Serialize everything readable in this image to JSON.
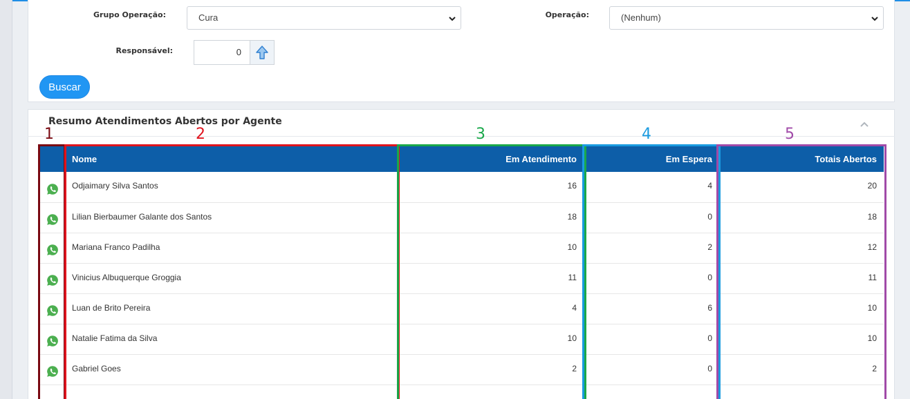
{
  "filters": {
    "grupo_label": "Grupo Operação:",
    "grupo_value": "Cura",
    "operacao_label": "Operação:",
    "operacao_value": "(Nenhum)",
    "responsavel_label": "Responsável:",
    "responsavel_value": "0",
    "buscar_label": "Buscar"
  },
  "summary": {
    "title": "Resumo Atendimentos Abertos por Agente",
    "columns": [
      "",
      "Nome",
      "Em Atendimento",
      "Em Espera",
      "Totais Abertos"
    ],
    "rows": [
      {
        "nome": "Odjaimary Silva Santos",
        "em_atendimento": "16",
        "em_espera": "4",
        "totais": "20"
      },
      {
        "nome": "Lilian Bierbaumer Galante dos Santos",
        "em_atendimento": "18",
        "em_espera": "0",
        "totais": "18"
      },
      {
        "nome": "Mariana Franco Padilha",
        "em_atendimento": "10",
        "em_espera": "2",
        "totais": "12"
      },
      {
        "nome": "Vinicius Albuquerque Groggia",
        "em_atendimento": "11",
        "em_espera": "0",
        "totais": "11"
      },
      {
        "nome": "Luan de Brito Pereira",
        "em_atendimento": "4",
        "em_espera": "6",
        "totais": "10"
      },
      {
        "nome": "Natalie Fatima da Silva",
        "em_atendimento": "10",
        "em_espera": "0",
        "totais": "10"
      },
      {
        "nome": "Gabriel Goes",
        "em_atendimento": "2",
        "em_espera": "0",
        "totais": "2"
      }
    ]
  },
  "annotations": {
    "labels": [
      "1",
      "2",
      "3",
      "4",
      "5"
    ],
    "colors": [
      "#7a0a12",
      "#e0141e",
      "#1aa84a",
      "#1a9be0",
      "#a04aa8"
    ]
  },
  "icons": {
    "row_icon": "whatsapp-icon",
    "lookup_icon": "arrow-up-icon",
    "collapse_icon": "chevron-up-icon",
    "select_icon": "chevron-down-icon"
  },
  "colors": {
    "header_bg": "#0d5ea8",
    "button_bg": "#2196f3",
    "whatsapp_green": "#4caf50"
  }
}
